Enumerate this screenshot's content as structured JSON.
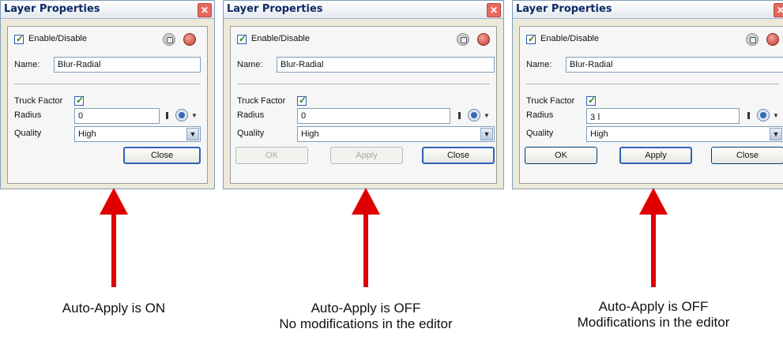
{
  "panels": [
    {
      "title": "Layer Properties",
      "close_symbol": "✕",
      "enable_label": "Enable/Disable",
      "name_label": "Name:",
      "name_value": "Blur-Radial",
      "truck_factor_label": "Truck Factor",
      "radius_label": "Radius",
      "radius_value": "0",
      "quality_label": "Quality",
      "quality_value": "High",
      "buttons": {
        "close": "Close"
      }
    },
    {
      "title": "Layer Properties",
      "close_symbol": "✕",
      "enable_label": "Enable/Disable",
      "name_label": "Name:",
      "name_value": "Blur-Radial",
      "truck_factor_label": "Truck Factor",
      "radius_label": "Radius",
      "radius_value": "0",
      "quality_label": "Quality",
      "quality_value": "High",
      "buttons": {
        "ok": "OK",
        "apply": "Apply",
        "close": "Close"
      }
    },
    {
      "title": "Layer Properties",
      "close_symbol": "✕",
      "enable_label": "Enable/Disable",
      "name_label": "Name:",
      "name_value": "Blur-Radial",
      "truck_factor_label": "Truck Factor",
      "radius_label": "Radius",
      "radius_value": "3",
      "quality_label": "Quality",
      "quality_value": "High",
      "buttons": {
        "ok": "OK",
        "apply": "Apply",
        "close": "Close"
      }
    }
  ],
  "captions": [
    {
      "line1": "Auto-Apply is ON"
    },
    {
      "line1": "Auto-Apply is OFF",
      "line2": "No modifications in the editor"
    },
    {
      "line1": "Auto-Apply is OFF",
      "line2": "Modifications in the editor"
    }
  ],
  "arrow_color": "#e00000"
}
